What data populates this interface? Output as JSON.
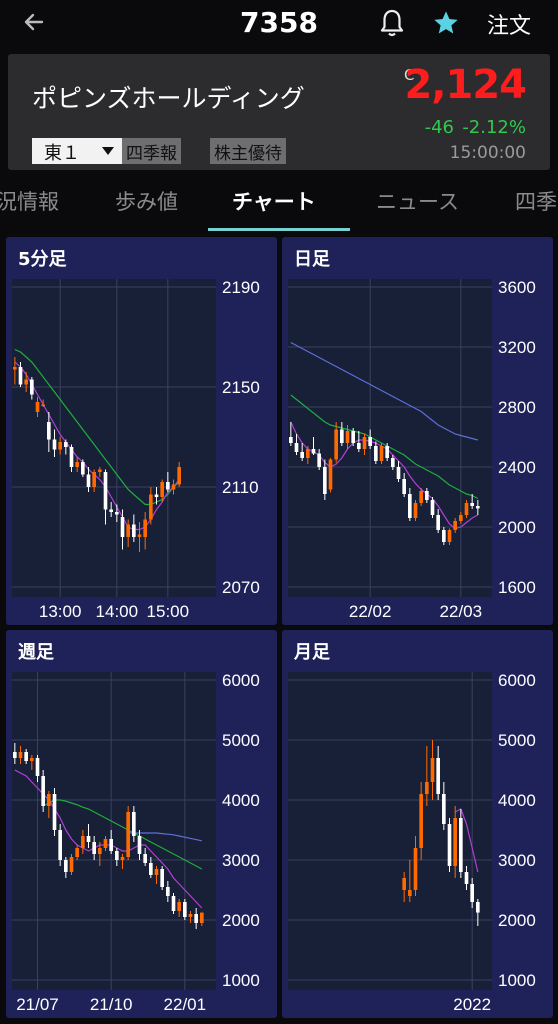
{
  "header": {
    "code": "7358",
    "order_label": "注文",
    "icons": [
      "back-arrow-icon",
      "bell-icon",
      "star-icon"
    ],
    "star_color": "#5bd2e4"
  },
  "stock": {
    "name": "ポピンズホールディング",
    "market": "東１",
    "tags": [
      "四季報",
      "株主優待"
    ],
    "price_prefix": "C",
    "price": "2,124",
    "change": "-46",
    "change_pct": "-2.12%",
    "time": "15:00:00",
    "price_color": "#ff1c1c",
    "change_color": "#30c94e"
  },
  "tabs": [
    "況情報",
    "歩み値",
    "チャート",
    "ニュース",
    "四季"
  ],
  "active_tab": "チャート",
  "colors": {
    "up": "#ff6a00",
    "down": "#ffffff",
    "ma_short": "#b23fd6",
    "ma_mid": "#1fae3b",
    "ma_long": "#5d6fd8",
    "panel_bg": "#1f2259",
    "plot_bg": "#182038"
  },
  "chart_data": [
    {
      "type": "candlestick",
      "title": "5分足",
      "y_ticks": [
        "2190",
        "2150",
        "2110",
        "2070"
      ],
      "ylim": [
        2070,
        2190
      ],
      "x_ticks": [
        "13:00",
        "14:00",
        "15:00"
      ],
      "x_tick_positions": [
        8,
        18,
        27
      ],
      "candles": [
        [
          2157,
          2162,
          2151,
          2158
        ],
        [
          2158,
          2160,
          2150,
          2151
        ],
        [
          2151,
          2156,
          2148,
          2153
        ],
        [
          2153,
          2154,
          2145,
          2147
        ],
        [
          2140,
          2146,
          2138,
          2144
        ],
        [
          2143,
          2145,
          2142,
          2143
        ],
        [
          2136,
          2140,
          2124,
          2129
        ],
        [
          2129,
          2133,
          2122,
          2125
        ],
        [
          2125,
          2130,
          2123,
          2128
        ],
        [
          2128,
          2129,
          2123,
          2126
        ],
        [
          2126,
          2127,
          2116,
          2118
        ],
        [
          2118,
          2122,
          2116,
          2120
        ],
        [
          2120,
          2121,
          2114,
          2115
        ],
        [
          2115,
          2118,
          2108,
          2110
        ],
        [
          2110,
          2117,
          2108,
          2116
        ],
        [
          2116,
          2118,
          2114,
          2117
        ],
        [
          2116,
          2117,
          2095,
          2101
        ],
        [
          2101,
          2104,
          2098,
          2100
        ],
        [
          2100,
          2103,
          2096,
          2099
        ],
        [
          2098,
          2101,
          2085,
          2090
        ],
        [
          2090,
          2097,
          2086,
          2095
        ],
        [
          2095,
          2099,
          2088,
          2090
        ],
        [
          2090,
          2096,
          2084,
          2091
        ],
        [
          2090,
          2100,
          2085,
          2097
        ],
        [
          2097,
          2110,
          2095,
          2107
        ],
        [
          2107,
          2110,
          2103,
          2106
        ],
        [
          2106,
          2113,
          2104,
          2112
        ],
        [
          2112,
          2116,
          2108,
          2109
        ],
        [
          2109,
          2113,
          2107,
          2111
        ],
        [
          2111,
          2120,
          2110,
          2118
        ]
      ],
      "ma_short": [
        2160,
        2158,
        2155,
        2151,
        2147,
        2143,
        2139,
        2135,
        2131,
        2128,
        2125,
        2122,
        2120,
        2117,
        2115,
        2113,
        2110,
        2106,
        2102,
        2098,
        2094,
        2093,
        2093,
        2094,
        2097,
        2101,
        2104,
        2108,
        2110,
        2113
      ],
      "ma_mid": [
        2165,
        2164,
        2162,
        2160,
        2157,
        2154,
        2151,
        2148,
        2145,
        2142,
        2139,
        2136,
        2133,
        2130,
        2127,
        2124,
        2121,
        2118,
        2115,
        2112,
        2109,
        2107,
        2105,
        2103,
        2103,
        2104,
        2105,
        2107,
        2110,
        2112
      ]
    },
    {
      "type": "candlestick",
      "title": "日足",
      "y_ticks": [
        "3600",
        "3200",
        "2800",
        "2400",
        "2000",
        "1600"
      ],
      "ylim": [
        1600,
        3600
      ],
      "x_ticks": [
        "22/02",
        "22/03"
      ],
      "x_tick_positions": [
        14,
        30
      ],
      "candles": [
        [
          2600,
          2700,
          2540,
          2560
        ],
        [
          2560,
          2620,
          2480,
          2500
        ],
        [
          2500,
          2560,
          2440,
          2460
        ],
        [
          2460,
          2540,
          2420,
          2520
        ],
        [
          2520,
          2600,
          2480,
          2490
        ],
        [
          2490,
          2520,
          2380,
          2400
        ],
        [
          2400,
          2450,
          2180,
          2220
        ],
        [
          2250,
          2460,
          2230,
          2450
        ],
        [
          2450,
          2700,
          2430,
          2650
        ],
        [
          2650,
          2700,
          2540,
          2560
        ],
        [
          2560,
          2680,
          2520,
          2640
        ],
        [
          2640,
          2660,
          2540,
          2560
        ],
        [
          2560,
          2640,
          2500,
          2520
        ],
        [
          2520,
          2620,
          2480,
          2600
        ],
        [
          2600,
          2650,
          2520,
          2540
        ],
        [
          2540,
          2570,
          2420,
          2440
        ],
        [
          2440,
          2560,
          2420,
          2540
        ],
        [
          2540,
          2560,
          2440,
          2460
        ],
        [
          2460,
          2480,
          2380,
          2400
        ],
        [
          2400,
          2440,
          2300,
          2320
        ],
        [
          2320,
          2360,
          2200,
          2220
        ],
        [
          2220,
          2260,
          2040,
          2060
        ],
        [
          2060,
          2180,
          2040,
          2160
        ],
        [
          2160,
          2260,
          2140,
          2240
        ],
        [
          2240,
          2260,
          2160,
          2180
        ],
        [
          2180,
          2200,
          2060,
          2080
        ],
        [
          2080,
          2120,
          1960,
          1980
        ],
        [
          1980,
          2000,
          1880,
          1900
        ],
        [
          1900,
          1990,
          1880,
          1980
        ],
        [
          1980,
          2060,
          1960,
          2040
        ],
        [
          2040,
          2100,
          2020,
          2080
        ],
        [
          2080,
          2180,
          2060,
          2160
        ],
        [
          2160,
          2220,
          2120,
          2140
        ],
        [
          2140,
          2180,
          2080,
          2124
        ]
      ],
      "ma_short": [
        2700,
        2620,
        2560,
        2520,
        2500,
        2480,
        2430,
        2400,
        2420,
        2460,
        2520,
        2560,
        2580,
        2580,
        2570,
        2560,
        2540,
        2520,
        2480,
        2440,
        2400,
        2340,
        2290,
        2250,
        2220,
        2190,
        2140,
        2080,
        2020,
        1990,
        2000,
        2030,
        2060,
        2080
      ],
      "ma_mid": [
        2880,
        2850,
        2820,
        2790,
        2760,
        2730,
        2700,
        2680,
        2670,
        2660,
        2650,
        2640,
        2630,
        2620,
        2600,
        2580,
        2560,
        2540,
        2520,
        2500,
        2480,
        2450,
        2420,
        2400,
        2380,
        2360,
        2340,
        2310,
        2280,
        2260,
        2240,
        2220,
        2210,
        2190
      ],
      "ma_long": [
        3230,
        3210,
        3190,
        3170,
        3150,
        3130,
        3110,
        3090,
        3070,
        3050,
        3030,
        3010,
        2990,
        2970,
        2950,
        2930,
        2910,
        2890,
        2870,
        2850,
        2830,
        2810,
        2790,
        2770,
        2740,
        2710,
        2680,
        2660,
        2640,
        2620,
        2610,
        2600,
        2590,
        2580
      ]
    },
    {
      "type": "candlestick",
      "title": "週足",
      "y_ticks": [
        "6000",
        "5000",
        "4000",
        "3000",
        "2000",
        "1000"
      ],
      "ylim": [
        1000,
        6000
      ],
      "x_ticks": [
        "21/07",
        "21/10",
        "22/01"
      ],
      "x_tick_positions": [
        4,
        17,
        30
      ],
      "candles": [
        [
          4800,
          4950,
          4600,
          4700
        ],
        [
          4700,
          4900,
          4600,
          4800
        ],
        [
          4800,
          4850,
          4600,
          4650
        ],
        [
          4650,
          4750,
          4500,
          4700
        ],
        [
          4700,
          4750,
          4300,
          4400
        ],
        [
          4400,
          4500,
          3800,
          3900
        ],
        [
          3900,
          4150,
          3700,
          4100
        ],
        [
          4100,
          4200,
          3400,
          3500
        ],
        [
          3500,
          3600,
          2900,
          3000
        ],
        [
          3000,
          3050,
          2700,
          2800
        ],
        [
          2800,
          3100,
          2750,
          3050
        ],
        [
          3050,
          3250,
          3000,
          3200
        ],
        [
          3200,
          3500,
          3100,
          3400
        ],
        [
          3400,
          3600,
          3200,
          3300
        ],
        [
          3300,
          3400,
          3000,
          3100
        ],
        [
          3100,
          3300,
          2900,
          3200
        ],
        [
          3200,
          3400,
          3150,
          3350
        ],
        [
          3350,
          3500,
          3100,
          3150
        ],
        [
          3150,
          3200,
          2900,
          3000
        ],
        [
          3000,
          3100,
          2850,
          3050
        ],
        [
          3050,
          3900,
          3000,
          3800
        ],
        [
          3800,
          3900,
          3300,
          3400
        ],
        [
          3400,
          3500,
          3000,
          3100
        ],
        [
          3100,
          3200,
          2900,
          2950
        ],
        [
          2950,
          3050,
          2700,
          2750
        ],
        [
          2750,
          2900,
          2600,
          2850
        ],
        [
          2850,
          2900,
          2500,
          2550
        ],
        [
          2550,
          2650,
          2300,
          2400
        ],
        [
          2400,
          2450,
          2100,
          2150
        ],
        [
          2150,
          2350,
          2050,
          2300
        ],
        [
          2300,
          2350,
          2000,
          2050
        ],
        [
          2050,
          2150,
          1950,
          2100
        ],
        [
          2100,
          2200,
          1850,
          1950
        ],
        [
          1950,
          2124,
          1900,
          2124
        ]
      ],
      "ma_short": [
        4500,
        4450,
        4400,
        4300,
        4200,
        4100,
        4000,
        3850,
        3700,
        3500,
        3350,
        3250,
        3200,
        3150,
        3200,
        3250,
        3250,
        3250,
        3200,
        3150,
        3150,
        3200,
        3250,
        3250,
        3150,
        3050,
        2950,
        2850,
        2700,
        2600,
        2500,
        2400,
        2300,
        2200
      ],
      "ma_mid": [
        null,
        null,
        null,
        null,
        null,
        3900,
        3950,
        4000,
        4000,
        3980,
        3950,
        3920,
        3880,
        3850,
        3800,
        3750,
        3700,
        3650,
        3600,
        3550,
        3500,
        3450,
        3400,
        3350,
        3300,
        3250,
        3200,
        3150,
        3100,
        3050,
        3000,
        2950,
        2900,
        2850
      ],
      "ma_long": [
        null,
        null,
        null,
        null,
        null,
        null,
        null,
        null,
        null,
        null,
        null,
        null,
        null,
        null,
        null,
        null,
        null,
        null,
        null,
        null,
        3450,
        3450,
        3450,
        3450,
        3450,
        3450,
        3440,
        3430,
        3420,
        3400,
        3380,
        3360,
        3340,
        3320
      ]
    },
    {
      "type": "candlestick",
      "title": "月足",
      "y_ticks": [
        "6000",
        "5000",
        "4000",
        "3000",
        "2000",
        "1000"
      ],
      "ylim": [
        1000,
        6000
      ],
      "x_ticks": [
        "2022"
      ],
      "x_tick_positions": [
        32
      ],
      "candles": [
        [
          2500,
          2800,
          2300,
          2700
        ],
        [
          2400,
          3000,
          2300,
          2500
        ],
        [
          2500,
          3400,
          2400,
          3200
        ],
        [
          3200,
          4300,
          3000,
          4100
        ],
        [
          4100,
          4900,
          3900,
          4300
        ],
        [
          4300,
          5000,
          4000,
          4700
        ],
        [
          4700,
          4900,
          4000,
          4100
        ],
        [
          4100,
          4300,
          3500,
          3600
        ],
        [
          3600,
          3700,
          2800,
          2900
        ],
        [
          2900,
          3900,
          2700,
          3700
        ],
        [
          3700,
          3850,
          2700,
          2800
        ],
        [
          2800,
          2900,
          2500,
          2600
        ],
        [
          2600,
          2700,
          2200,
          2300
        ],
        [
          2300,
          2350,
          1900,
          2124
        ]
      ],
      "candle_start": 20,
      "ma_short": [
        null,
        null,
        null,
        null,
        null,
        null,
        null,
        null,
        null,
        3800,
        3850,
        3600,
        3200,
        2800
      ],
      "ma_short_start": 20
    }
  ]
}
